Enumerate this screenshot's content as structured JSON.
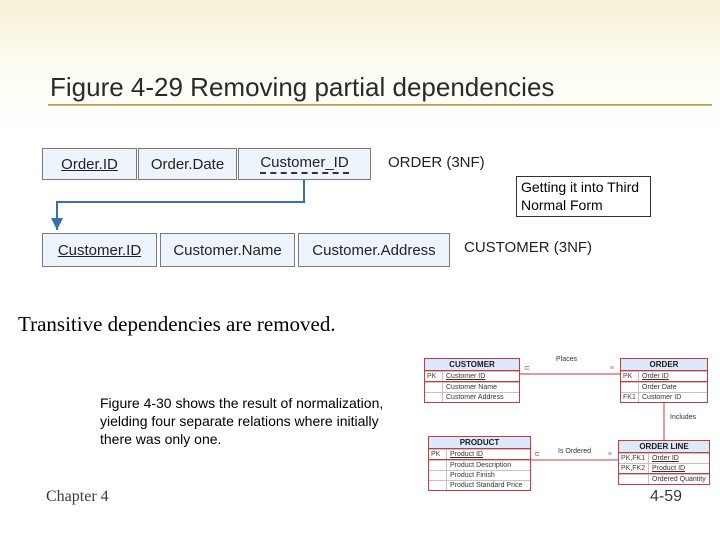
{
  "slide": {
    "title": "Figure 4-29 Removing partial dependencies",
    "callout": "Transitive dependencies are removed.",
    "paragraph": "Figure 4-30 shows the result of normalization, yielding four separate relations where initially there was only one.",
    "chapter": "Chapter 4",
    "page": "4-59"
  },
  "note": {
    "text": "Getting it into Third Normal Form"
  },
  "diagram": {
    "order": {
      "cols": {
        "order_id": "Order.ID",
        "order_date": "Order.Date",
        "customer_id": "Customer_ID"
      },
      "label": "ORDER (3NF)"
    },
    "customer": {
      "cols": {
        "customer_id": "Customer.ID",
        "customer_name": "Customer.Name",
        "customer_address": "Customer.Address"
      },
      "label": "CUSTOMER (3NF)"
    }
  },
  "erd": {
    "customer": {
      "title": "CUSTOMER",
      "pk_label": "PK",
      "pk": "Customer ID",
      "attrs": [
        "Customer Name",
        "Customer Address"
      ]
    },
    "order": {
      "title": "ORDER",
      "pk_label": "PK",
      "pk": "Order ID",
      "fk1_label": "FK1",
      "attrs": [
        "Order Date",
        "Customer ID"
      ]
    },
    "product": {
      "title": "PRODUCT",
      "pk_label": "PK",
      "pk": "Product ID",
      "attrs": [
        "Product Description",
        "Product Finish",
        "Product Standard Price"
      ]
    },
    "order_line": {
      "title": "ORDER LINE",
      "k1_label": "PK,FK1",
      "k1": "Order ID",
      "k2_label": "PK,FK2",
      "k2": "Product ID",
      "attrs": [
        "Ordered Quantity"
      ]
    },
    "rels": {
      "places": "Places",
      "includes": "Includes",
      "is_ordered": "Is Ordered"
    }
  }
}
